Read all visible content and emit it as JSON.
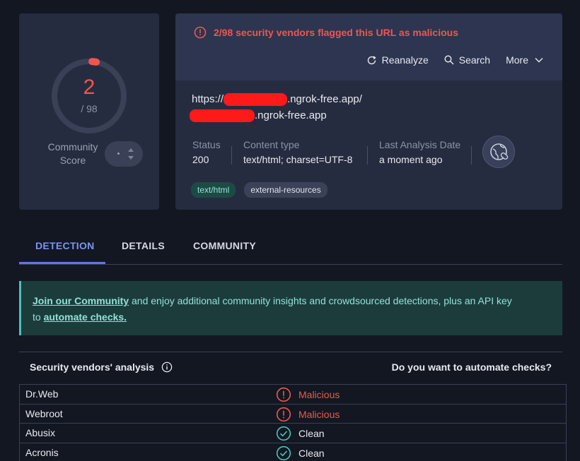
{
  "score": {
    "detections": "2",
    "total": "/ 98",
    "community_label": "Community Score",
    "ring_fraction": 0.02
  },
  "alert": {
    "text": "2/98 security vendors flagged this URL as malicious"
  },
  "actions": {
    "reanalyze": "Reanalyze",
    "search": "Search",
    "more": "More"
  },
  "url": {
    "line1_prefix": "https://",
    "line1_suffix": ".ngrok-free.app/",
    "line2_suffix": ".ngrok-free.app"
  },
  "meta": {
    "status_label": "Status",
    "status_value": "200",
    "content_type_label": "Content type",
    "content_type_value": "text/html; charset=UTF-8",
    "last_analysis_label": "Last Analysis Date",
    "last_analysis_value": "a moment ago"
  },
  "tags": [
    "text/html",
    "external-resources"
  ],
  "tabs": [
    "DETECTION",
    "DETAILS",
    "COMMUNITY"
  ],
  "banner": {
    "link1": "Join our Community",
    "text1": " and enjoy additional community insights and crowdsourced detections, plus an API key",
    "text2": "to ",
    "link2": "automate checks."
  },
  "vendors": {
    "title": "Security vendors' analysis",
    "right_text": "Do you want to automate checks?",
    "rows": [
      {
        "name": "Dr.Web",
        "result": "Malicious",
        "status": "malicious"
      },
      {
        "name": "Webroot",
        "result": "Malicious",
        "status": "malicious"
      },
      {
        "name": "Abusix",
        "result": "Clean",
        "status": "clean"
      },
      {
        "name": "Acronis",
        "result": "Clean",
        "status": "clean"
      }
    ]
  },
  "colors": {
    "malicious": "#f0564e",
    "clean": "#4cc3b6",
    "accent": "#5a78e8",
    "redaction": "#ff1a1a"
  },
  "icons": {
    "alert": "alert-circle-icon",
    "reanalyze": "refresh-icon",
    "search": "search-icon",
    "more": "chevron-down-icon",
    "globe": "globe-link-icon",
    "info": "info-icon",
    "check": "check-circle-icon"
  }
}
